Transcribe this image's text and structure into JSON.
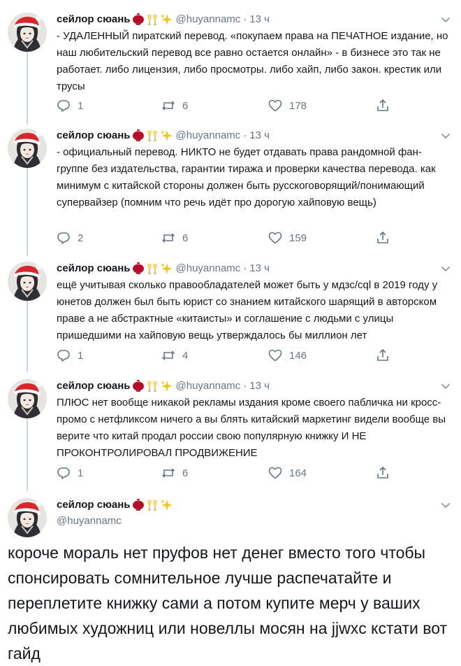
{
  "tweets": [
    {
      "name": "сейлор сюань",
      "handle": "@huyannamc",
      "time": "13 ч",
      "text": "- УДАЛЕННЫЙ пиратский перевод. «покупаем права на ПЕЧАТНОЕ издание, но наш любительский перевод все равно остается онлайн» - в бизнесе это так не работает. либо лицензия, либо просмотры. либо хайп, либо закон. крестик или трусы",
      "replies": "1",
      "retweets": "6",
      "likes": "178"
    },
    {
      "name": "сейлор сюань",
      "handle": "@huyannamc",
      "time": "13 ч",
      "text": "- официальный перевод. НИКТО не будет отдавать права рандомной фан-группе без издательства, гарантии тиража и проверки качества перевода. как минимум с китайской стороны должен быть русскоговорящий/понимающий супервайзер (помним что речь идёт про дорогую хайповую вещь)",
      "replies": "2",
      "retweets": "6",
      "likes": "159"
    },
    {
      "name": "сейлор сюань",
      "handle": "@huyannamc",
      "time": "13 ч",
      "text": "ещё учитывая сколько правообладателей может быть у мдзс/cql в 2019 году у юнетов должен был быть юрист со знанием китайского шарящий в авторском праве а не абстрактные «китаисты» и соглашение с людьми с улицы пришедшими на хайповую вещь утверждалось бы миллион лет",
      "replies": "1",
      "retweets": "4",
      "likes": "146"
    },
    {
      "name": "сейлор сюань",
      "handle": "@huyannamc",
      "time": "13 ч",
      "text": "ПЛЮС нет вообще никакой рекламы издания кроме своего пабличка ни кросс-промо с нетфликсом ничего а вы блять китайский маркетинг видели вообще вы верите что китай продал россии свою популярную книжку И НЕ ПРОКОНТРОЛИРОВАЛ ПРОДВИЖЕНИЕ",
      "replies": "1",
      "retweets": "6",
      "likes": "164"
    }
  ],
  "final_tweet": {
    "name": "сейлор сюань",
    "handle": "@huyannamc",
    "text": "короче мораль нет пруфов нет денег вместо того чтобы спонсировать сомнительное лучше распечатайте и переплетите книжку сами а потом купите мерч у ваших любимых художниц или новеллы мосян на jjwxc кстати вот гайд"
  },
  "colors": {
    "text": "#14171a",
    "secondary": "#657786",
    "thread": "#ccd6dd"
  },
  "icons": [
    "avatar",
    "lantern-emoji",
    "cheers-emoji",
    "sparkles-emoji",
    "caret-down-icon",
    "reply-icon",
    "retweet-icon",
    "like-icon",
    "share-icon"
  ]
}
